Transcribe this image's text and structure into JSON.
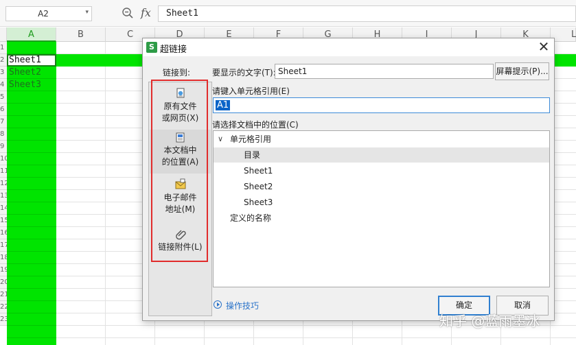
{
  "formula_bar": {
    "name_box": "A2",
    "formula": "Sheet1",
    "fx": "fx"
  },
  "columns": [
    "A",
    "B",
    "C",
    "D",
    "E",
    "F",
    "G",
    "H",
    "I",
    "J",
    "K",
    "L"
  ],
  "rows": [
    "1",
    "2",
    "3",
    "4",
    "5",
    "6",
    "7",
    "8",
    "9",
    "10",
    "11",
    "12",
    "13",
    "14",
    "15",
    "16",
    "17",
    "18",
    "19",
    "20",
    "21",
    "22",
    "23"
  ],
  "cells": {
    "a2": "Sheet1",
    "a3": "Sheet2",
    "a4": "Sheet3"
  },
  "dialog": {
    "title": "超链接",
    "link_to_label": "链接到:",
    "display_text_label": "要显示的文字(T):",
    "display_text_value": "Sheet1",
    "screen_tip_button": "屏幕提示(P)...",
    "cell_ref_label": "请键入单元格引用(E)",
    "cell_ref_value": "A1",
    "location_label": "请选择文档中的位置(C)",
    "link_options": [
      {
        "line1": "原有文件",
        "line2": "或网页(X)"
      },
      {
        "line1": "本文档中",
        "line2": "的位置(A)"
      },
      {
        "line1": "电子邮件",
        "line2": "地址(M)"
      },
      {
        "line1": "链接附件(L)",
        "line2": ""
      }
    ],
    "tree": {
      "group1": "单元格引用",
      "items": [
        "目录",
        "Sheet1",
        "Sheet2",
        "Sheet3"
      ],
      "group2": "定义的名称"
    },
    "tips_link": "操作技巧",
    "ok_button": "确定",
    "cancel_button": "取消"
  },
  "watermark": "知乎 @蓝雨墨冰",
  "colors": {
    "highlight_green": "#00e400",
    "annotation_red": "#e12b2b",
    "selection_blue": "#0a64c8"
  }
}
